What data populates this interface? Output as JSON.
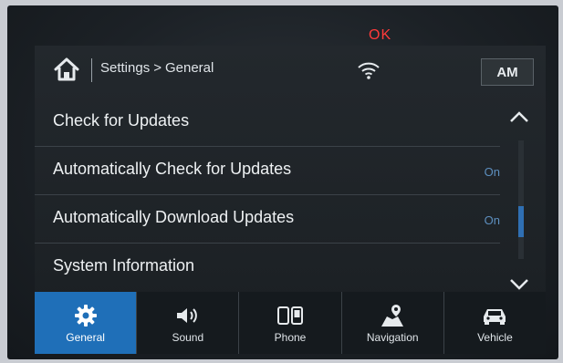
{
  "annotation": {
    "label": "OK"
  },
  "header": {
    "breadcrumb_parent": "Settings",
    "breadcrumb_separator": ">",
    "breadcrumb_current": "General",
    "am_label": "AM"
  },
  "list": [
    {
      "label": "Check for Updates",
      "value": ""
    },
    {
      "label": "Automatically Check for Updates",
      "value": "On"
    },
    {
      "label": "Automatically Download Updates",
      "value": "On"
    },
    {
      "label": "System Information",
      "value": ""
    }
  ],
  "scroll": {
    "position_fraction": 0.75
  },
  "tabs": [
    {
      "label": "General",
      "icon": "gear-icon",
      "active": true
    },
    {
      "label": "Sound",
      "icon": "speaker-icon",
      "active": false
    },
    {
      "label": "Phone",
      "icon": "phone-icon",
      "active": false
    },
    {
      "label": "Navigation",
      "icon": "map-pin-icon",
      "active": false
    },
    {
      "label": "Vehicle",
      "icon": "car-icon",
      "active": false
    }
  ],
  "colors": {
    "accent": "#1f6fb8",
    "annotation": "#e01c1c",
    "value_text": "#5d8fbf"
  }
}
